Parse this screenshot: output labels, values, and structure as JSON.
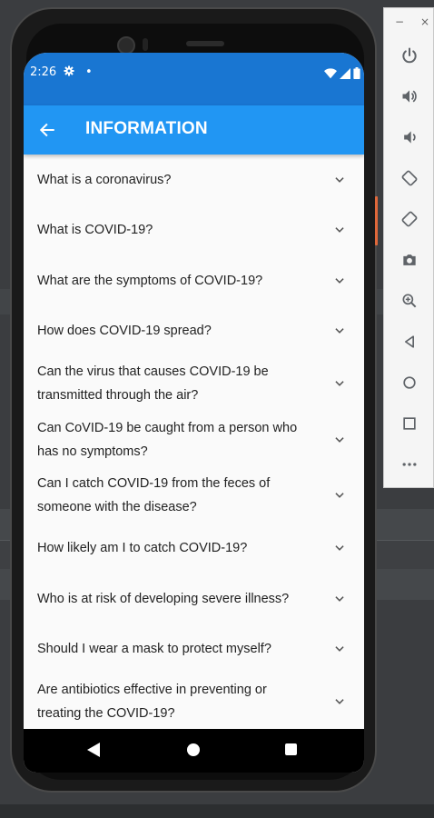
{
  "status_bar": {
    "time": "2:26",
    "gear_icon": "settings-gear-icon",
    "dot": "•"
  },
  "app_bar": {
    "title": "INFORMATION",
    "back_icon": "arrow-left-icon"
  },
  "faq": [
    {
      "question": "What is a coronavirus?"
    },
    {
      "question": "What is COVID-19?"
    },
    {
      "question": "What are the symptoms of COVID-19?"
    },
    {
      "question": "How does COVID-19 spread?"
    },
    {
      "question": "Can the virus that causes COVID-19 be transmitted through the air?"
    },
    {
      "question": "Can CoVID-19 be caught from a person who has no symptoms?"
    },
    {
      "question": "Can I catch COVID-19 from the feces of someone with the disease?"
    },
    {
      "question": "How likely am I to catch COVID-19?"
    },
    {
      "question": "Who is at risk of developing severe illness?"
    },
    {
      "question": "Should I wear a mask to protect myself?"
    },
    {
      "question": "Are antibiotics effective in preventing or treating the COVID-19?"
    }
  ],
  "emulator_toolbar": {
    "minimize": "−",
    "close": "×",
    "buttons": [
      "power-icon",
      "volume-up-icon",
      "volume-down-icon",
      "rotate-left-icon",
      "rotate-right-icon",
      "camera-icon",
      "zoom-icon",
      "back-triangle-icon",
      "home-circle-icon",
      "overview-square-icon",
      "more-icon"
    ]
  },
  "colors": {
    "status_bar": "#1976d2",
    "app_bar": "#2196f3",
    "list_bg": "#fafafa",
    "text": "#222222"
  }
}
